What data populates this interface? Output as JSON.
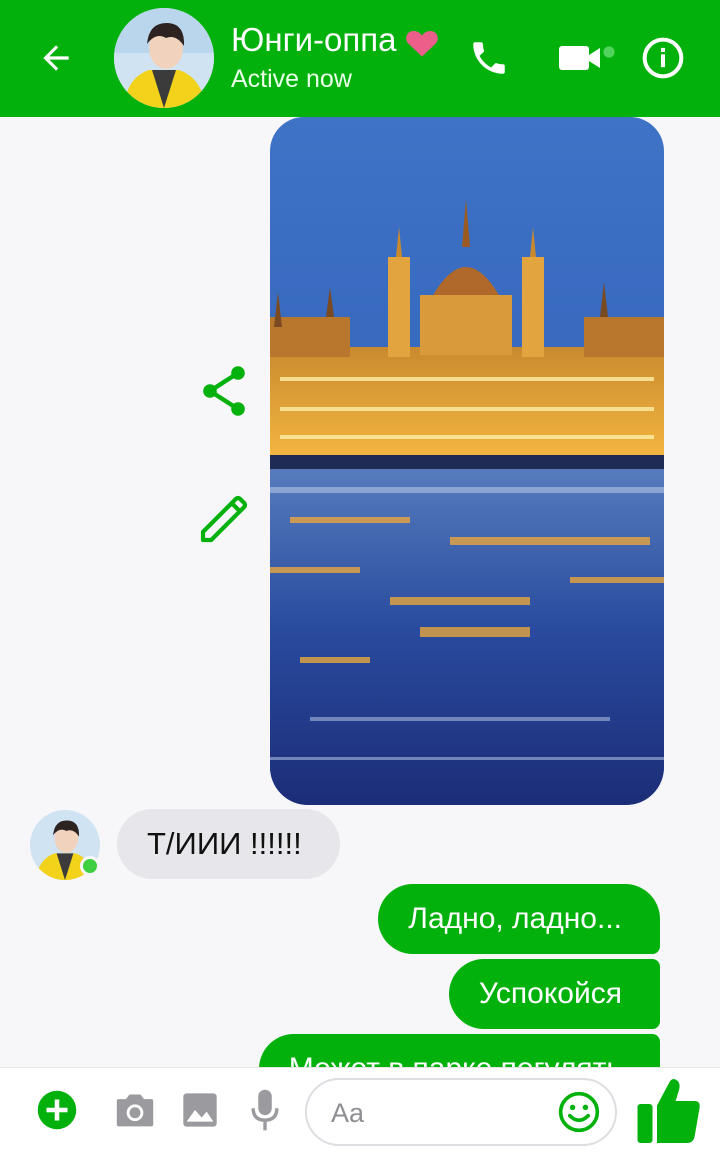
{
  "header": {
    "contact_name": "Юнги-оппа",
    "status": "Active now",
    "accent_color": "#03b10d"
  },
  "messages": [
    {
      "direction": "outgoing",
      "type": "image",
      "image_description": "Hungarian Parliament Building at night reflected in river"
    },
    {
      "direction": "incoming",
      "type": "text",
      "text": "Т/ИИИ !!!!!!"
    },
    {
      "direction": "outgoing",
      "type": "text",
      "text": "Ладно, ладно..."
    },
    {
      "direction": "outgoing",
      "type": "text",
      "text": "Успокойся"
    },
    {
      "direction": "outgoing",
      "type": "text",
      "text": "Может в парке погулять"
    }
  ],
  "composer": {
    "placeholder": "Aa"
  },
  "icons": {
    "back": "arrow-left-icon",
    "call": "phone-icon",
    "video": "video-camera-icon",
    "info": "info-icon",
    "share": "share-icon",
    "edit": "pencil-icon",
    "add": "plus-circle-icon",
    "camera": "camera-icon",
    "gallery": "image-icon",
    "mic": "microphone-icon",
    "emoji": "smiley-icon",
    "like": "thumbs-up-icon"
  }
}
